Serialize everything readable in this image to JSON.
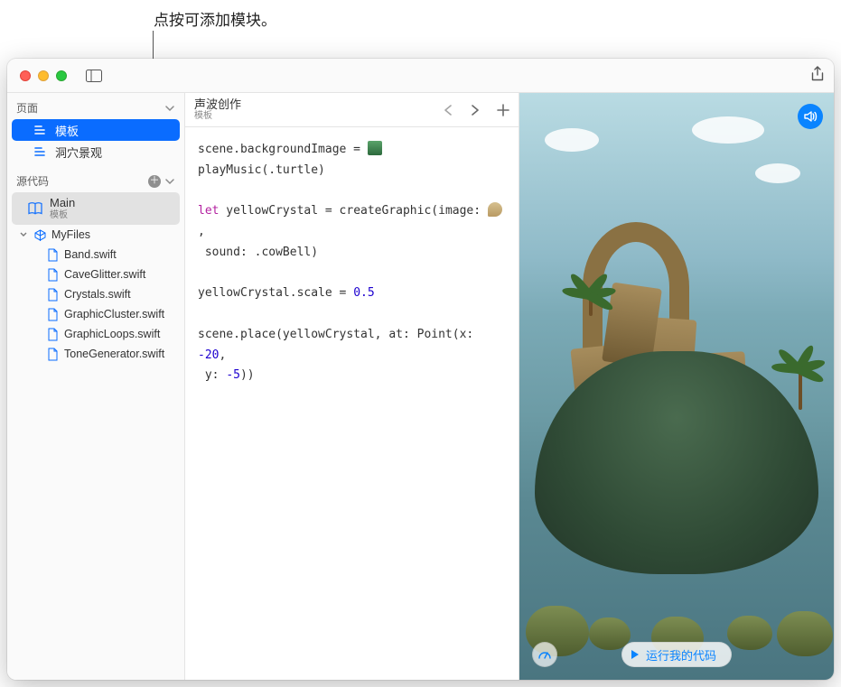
{
  "callout": "点按可添加模块。",
  "sidebar": {
    "pages_header": "页面",
    "pages": [
      "模板",
      "洞穴景观"
    ],
    "source_header": "源代码",
    "main": {
      "name": "Main",
      "subtitle": "模板"
    },
    "folder": "MyFiles",
    "files": [
      "Band.swift",
      "CaveGlitter.swift",
      "Crystals.swift",
      "GraphicCluster.swift",
      "GraphicLoops.swift",
      "ToneGenerator.swift"
    ]
  },
  "editor": {
    "title": "声波创作",
    "breadcrumb": "模板",
    "code": {
      "l1a": "scene.backgroundImage = ",
      "l2": "playMusic(.turtle)",
      "l3a": "let",
      "l3b": " yellowCrystal = createGraphic(image: ",
      "l3c": ",",
      "l4": " sound: .cowBell)",
      "l5a": "yellowCrystal.scale = ",
      "l5n": "0.5",
      "l6a": "scene.place(yellowCrystal, at: Point(x: ",
      "l6n1": "-20",
      "l6b": ",",
      "l7a": " y: ",
      "l7n": "-5",
      "l7b": "))"
    }
  },
  "preview": {
    "run_label": "运行我的代码"
  }
}
